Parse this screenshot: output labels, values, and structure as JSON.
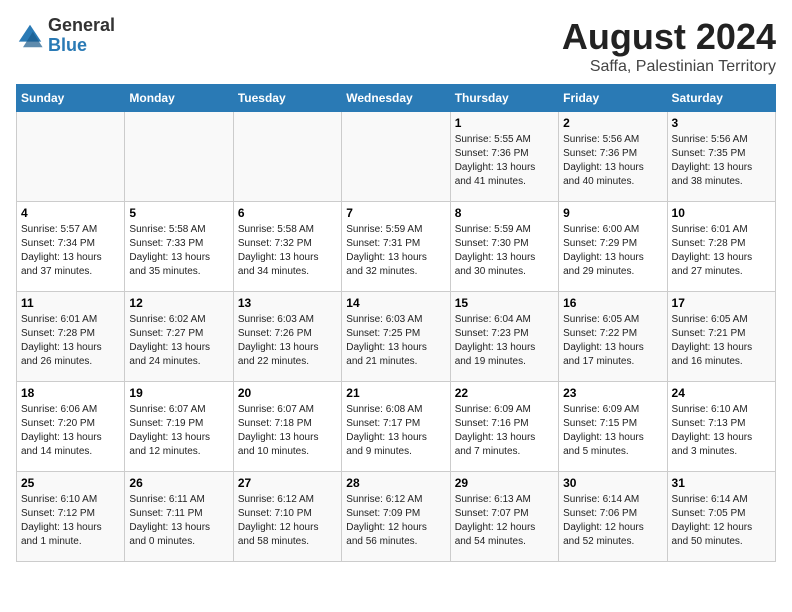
{
  "logo": {
    "general": "General",
    "blue": "Blue"
  },
  "title": "August 2024",
  "subtitle": "Saffa, Palestinian Territory",
  "days_of_week": [
    "Sunday",
    "Monday",
    "Tuesday",
    "Wednesday",
    "Thursday",
    "Friday",
    "Saturday"
  ],
  "weeks": [
    [
      {
        "day": "",
        "info": ""
      },
      {
        "day": "",
        "info": ""
      },
      {
        "day": "",
        "info": ""
      },
      {
        "day": "",
        "info": ""
      },
      {
        "day": "1",
        "sunrise": "5:55 AM",
        "sunset": "7:36 PM",
        "daylight": "13 hours and 41 minutes."
      },
      {
        "day": "2",
        "sunrise": "5:56 AM",
        "sunset": "7:36 PM",
        "daylight": "13 hours and 40 minutes."
      },
      {
        "day": "3",
        "sunrise": "5:56 AM",
        "sunset": "7:35 PM",
        "daylight": "13 hours and 38 minutes."
      }
    ],
    [
      {
        "day": "4",
        "sunrise": "5:57 AM",
        "sunset": "7:34 PM",
        "daylight": "13 hours and 37 minutes."
      },
      {
        "day": "5",
        "sunrise": "5:58 AM",
        "sunset": "7:33 PM",
        "daylight": "13 hours and 35 minutes."
      },
      {
        "day": "6",
        "sunrise": "5:58 AM",
        "sunset": "7:32 PM",
        "daylight": "13 hours and 34 minutes."
      },
      {
        "day": "7",
        "sunrise": "5:59 AM",
        "sunset": "7:31 PM",
        "daylight": "13 hours and 32 minutes."
      },
      {
        "day": "8",
        "sunrise": "5:59 AM",
        "sunset": "7:30 PM",
        "daylight": "13 hours and 30 minutes."
      },
      {
        "day": "9",
        "sunrise": "6:00 AM",
        "sunset": "7:29 PM",
        "daylight": "13 hours and 29 minutes."
      },
      {
        "day": "10",
        "sunrise": "6:01 AM",
        "sunset": "7:28 PM",
        "daylight": "13 hours and 27 minutes."
      }
    ],
    [
      {
        "day": "11",
        "sunrise": "6:01 AM",
        "sunset": "7:28 PM",
        "daylight": "13 hours and 26 minutes."
      },
      {
        "day": "12",
        "sunrise": "6:02 AM",
        "sunset": "7:27 PM",
        "daylight": "13 hours and 24 minutes."
      },
      {
        "day": "13",
        "sunrise": "6:03 AM",
        "sunset": "7:26 PM",
        "daylight": "13 hours and 22 minutes."
      },
      {
        "day": "14",
        "sunrise": "6:03 AM",
        "sunset": "7:25 PM",
        "daylight": "13 hours and 21 minutes."
      },
      {
        "day": "15",
        "sunrise": "6:04 AM",
        "sunset": "7:23 PM",
        "daylight": "13 hours and 19 minutes."
      },
      {
        "day": "16",
        "sunrise": "6:05 AM",
        "sunset": "7:22 PM",
        "daylight": "13 hours and 17 minutes."
      },
      {
        "day": "17",
        "sunrise": "6:05 AM",
        "sunset": "7:21 PM",
        "daylight": "13 hours and 16 minutes."
      }
    ],
    [
      {
        "day": "18",
        "sunrise": "6:06 AM",
        "sunset": "7:20 PM",
        "daylight": "13 hours and 14 minutes."
      },
      {
        "day": "19",
        "sunrise": "6:07 AM",
        "sunset": "7:19 PM",
        "daylight": "13 hours and 12 minutes."
      },
      {
        "day": "20",
        "sunrise": "6:07 AM",
        "sunset": "7:18 PM",
        "daylight": "13 hours and 10 minutes."
      },
      {
        "day": "21",
        "sunrise": "6:08 AM",
        "sunset": "7:17 PM",
        "daylight": "13 hours and 9 minutes."
      },
      {
        "day": "22",
        "sunrise": "6:09 AM",
        "sunset": "7:16 PM",
        "daylight": "13 hours and 7 minutes."
      },
      {
        "day": "23",
        "sunrise": "6:09 AM",
        "sunset": "7:15 PM",
        "daylight": "13 hours and 5 minutes."
      },
      {
        "day": "24",
        "sunrise": "6:10 AM",
        "sunset": "7:13 PM",
        "daylight": "13 hours and 3 minutes."
      }
    ],
    [
      {
        "day": "25",
        "sunrise": "6:10 AM",
        "sunset": "7:12 PM",
        "daylight": "13 hours and 1 minute."
      },
      {
        "day": "26",
        "sunrise": "6:11 AM",
        "sunset": "7:11 PM",
        "daylight": "13 hours and 0 minutes."
      },
      {
        "day": "27",
        "sunrise": "6:12 AM",
        "sunset": "7:10 PM",
        "daylight": "12 hours and 58 minutes."
      },
      {
        "day": "28",
        "sunrise": "6:12 AM",
        "sunset": "7:09 PM",
        "daylight": "12 hours and 56 minutes."
      },
      {
        "day": "29",
        "sunrise": "6:13 AM",
        "sunset": "7:07 PM",
        "daylight": "12 hours and 54 minutes."
      },
      {
        "day": "30",
        "sunrise": "6:14 AM",
        "sunset": "7:06 PM",
        "daylight": "12 hours and 52 minutes."
      },
      {
        "day": "31",
        "sunrise": "6:14 AM",
        "sunset": "7:05 PM",
        "daylight": "12 hours and 50 minutes."
      }
    ]
  ],
  "labels": {
    "sunrise": "Sunrise:",
    "sunset": "Sunset:",
    "daylight": "Daylight:"
  }
}
